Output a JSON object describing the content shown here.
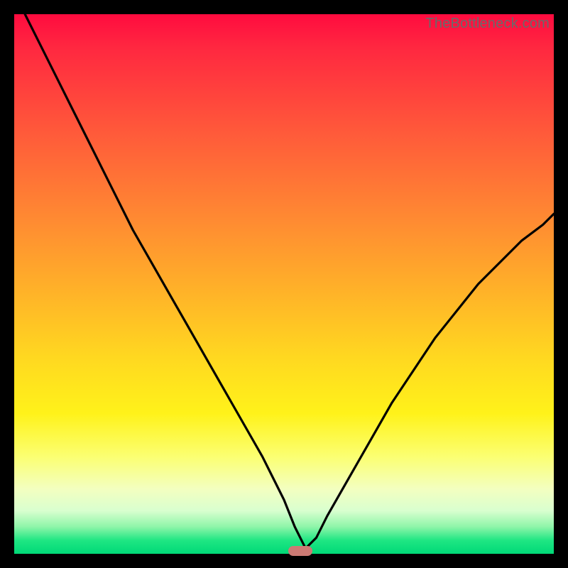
{
  "watermark": "TheBottleneck.com",
  "colors": {
    "frame": "#000000",
    "curve": "#000000",
    "marker": "#cc7a74",
    "gradient_top": "#ff0b3f",
    "gradient_bottom": "#00d977"
  },
  "chart_data": {
    "type": "line",
    "title": "",
    "xlabel": "",
    "ylabel": "",
    "xlim": [
      0,
      100
    ],
    "ylim": [
      0,
      100
    ],
    "grid": false,
    "note": "V-shaped bottleneck curve on red→green gradient; minimum (optimal point) marked by pill. Values estimated from pixel positions (no axis ticks present).",
    "series": [
      {
        "name": "bottleneck-curve",
        "x": [
          2,
          6,
          10,
          14,
          18,
          22,
          26,
          30,
          34,
          38,
          42,
          46,
          50,
          52,
          54,
          56,
          58,
          62,
          66,
          70,
          74,
          78,
          82,
          86,
          90,
          94,
          98,
          100
        ],
        "y": [
          100,
          92,
          84,
          76,
          68,
          60,
          53,
          46,
          39,
          32,
          25,
          18,
          10,
          5,
          1,
          3,
          7,
          14,
          21,
          28,
          34,
          40,
          45,
          50,
          54,
          58,
          61,
          63
        ]
      }
    ],
    "marker": {
      "x": 53,
      "y": 0.5,
      "label": "optimal-point"
    }
  }
}
